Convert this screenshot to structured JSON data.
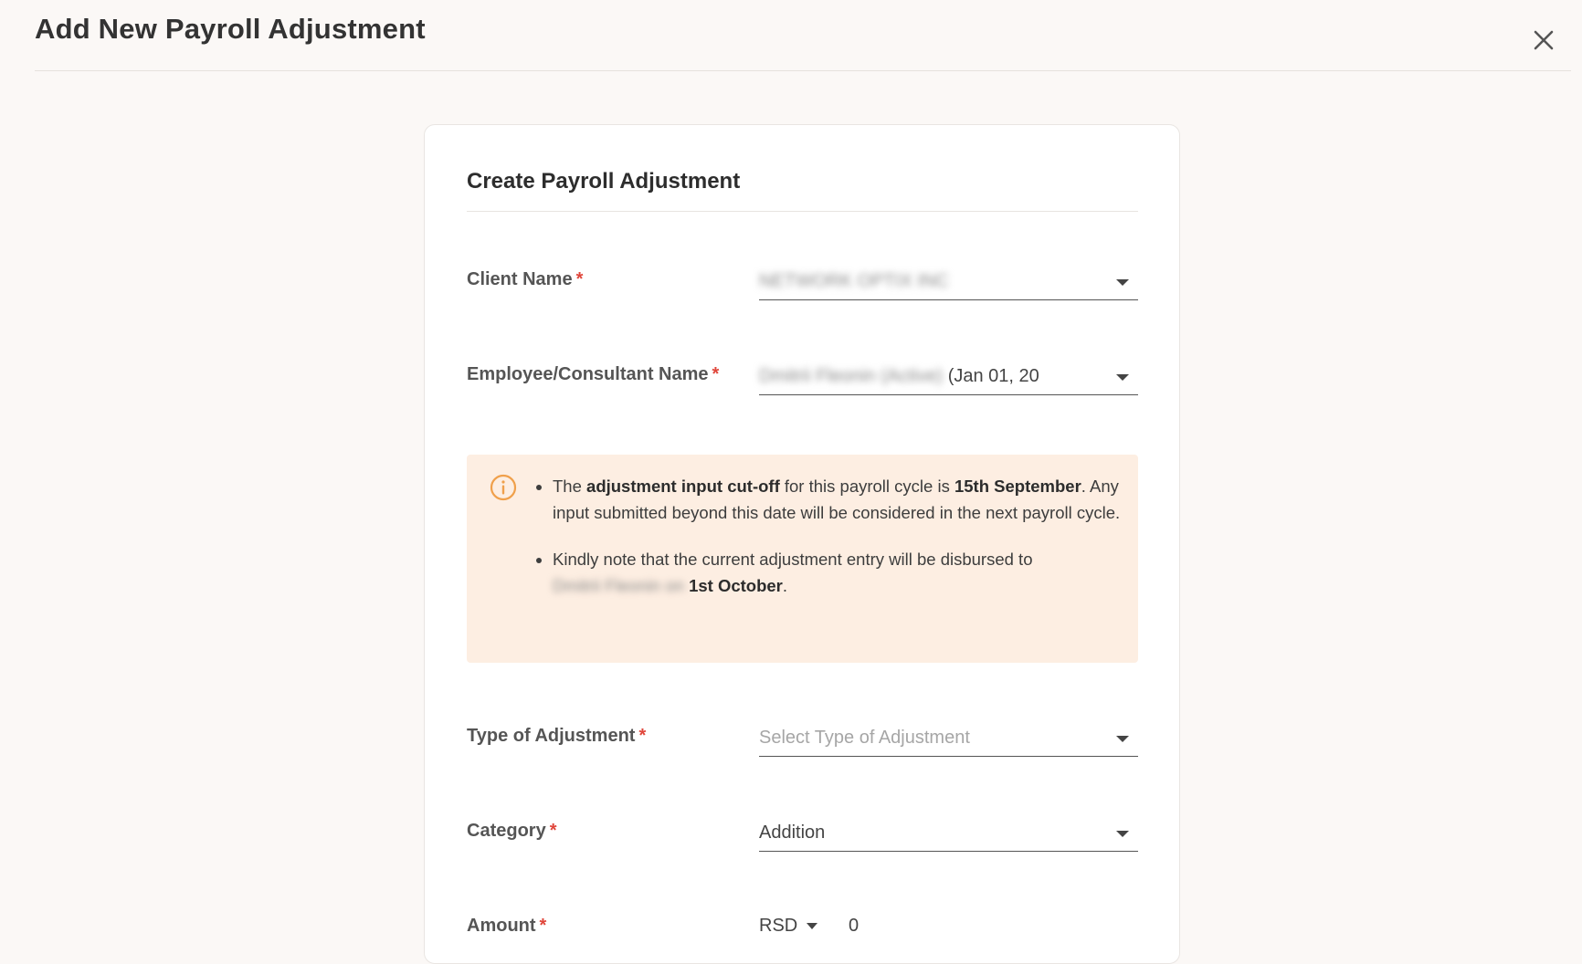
{
  "header": {
    "title": "Add New Payroll Adjustment",
    "close_icon": "close-icon"
  },
  "card": {
    "title": "Create Payroll Adjustment",
    "fields": {
      "client_name": {
        "label": "Client Name",
        "required": "*",
        "value": "NETWORK OPTIX INC"
      },
      "employee_name": {
        "label": "Employee/Consultant Name",
        "required": "*",
        "value_blurred": "Dmitrii Fleonin (Active)",
        "value_suffix": " (Jan 01, 20"
      },
      "type_of_adjustment": {
        "label": "Type of Adjustment",
        "required": "*",
        "placeholder": "Select Type of Adjustment"
      },
      "category": {
        "label": "Category",
        "required": "*",
        "value": "Addition"
      },
      "amount": {
        "label": "Amount",
        "required": "*",
        "currency": "RSD",
        "value": "0"
      }
    },
    "notice": {
      "icon": "info-icon",
      "item1": {
        "t1": "The ",
        "b1": "adjustment input cut-off",
        "t2": " for this payroll cycle is ",
        "b2": "15th September",
        "t3": ". Any input submitted beyond this date will be considered in the next payroll cycle."
      },
      "item2": {
        "t1": "Kindly note that the current adjustment entry will be disbursed to ",
        "blurred_name": "Dmitrii Fleonin on",
        "b1": "1st October",
        "t2": "."
      }
    }
  },
  "colors": {
    "background": "#fbf8f6",
    "notice_bg": "#fdeee2",
    "info_icon": "#f0a04b",
    "required": "#e0463b"
  }
}
